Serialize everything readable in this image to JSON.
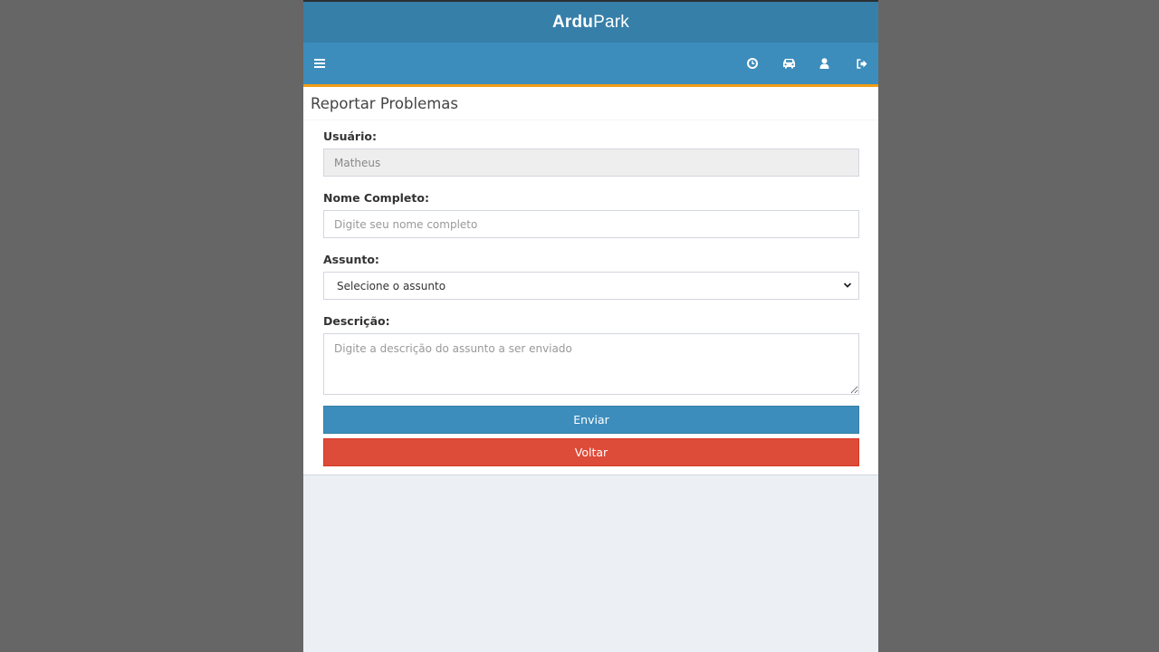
{
  "header": {
    "brand_bold": "Ardu",
    "brand_light": "Park"
  },
  "navbar": {
    "icons": [
      "menu-icon",
      "clock-icon",
      "car-icon",
      "user-icon",
      "logout-icon"
    ]
  },
  "page": {
    "title": "Reportar Problemas"
  },
  "form": {
    "usuario": {
      "label": "Usuário:",
      "value": "Matheus"
    },
    "nome": {
      "label": "Nome Completo:",
      "placeholder": "Digite seu nome completo"
    },
    "assunto": {
      "label": "Assunto:",
      "selected": "Selecione o assunto"
    },
    "descricao": {
      "label": "Descrição:",
      "placeholder": "Digite a descrição do assunto a ser enviado"
    },
    "submit_label": "Enviar",
    "back_label": "Voltar"
  },
  "colors": {
    "primary": "#3c8dbc",
    "header": "#367fa9",
    "danger": "#dd4b39",
    "accent": "#f39c12"
  }
}
